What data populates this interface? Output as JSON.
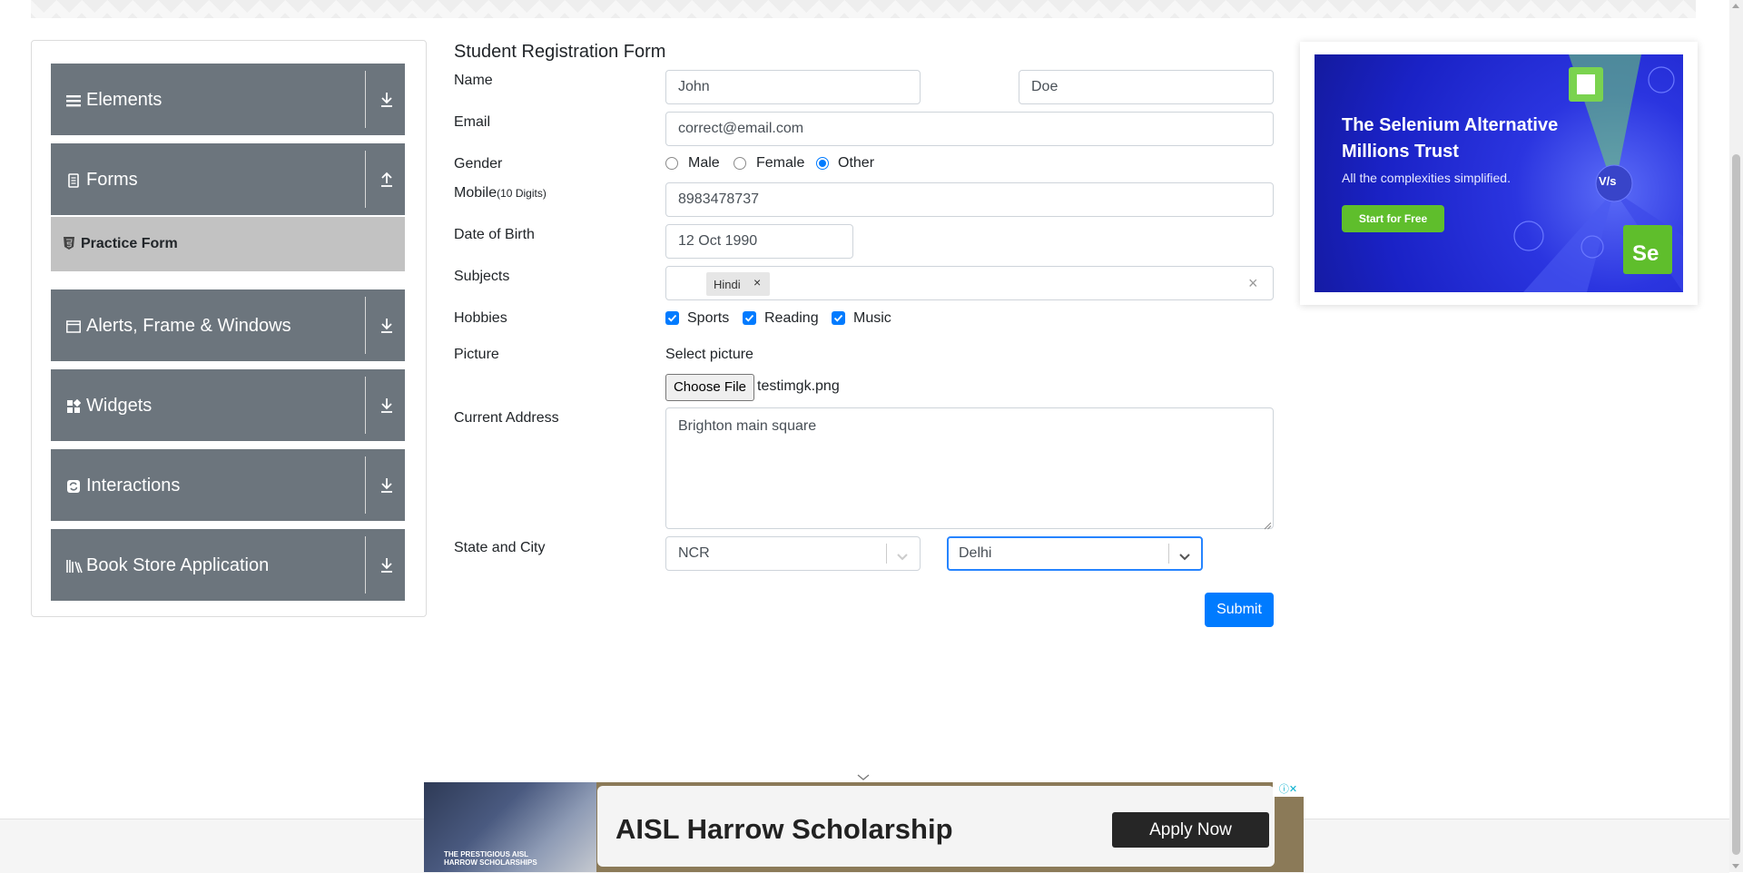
{
  "sidebar": {
    "groups": [
      {
        "label": "Elements",
        "icon": "hamburger-icon",
        "arrow": "download-icon"
      },
      {
        "label": "Forms",
        "icon": "document-icon",
        "arrow": "upload-icon"
      },
      {
        "label": "Alerts, Frame & Windows",
        "icon": "window-icon",
        "arrow": "download-icon"
      },
      {
        "label": "Widgets",
        "icon": "widgets-icon",
        "arrow": "download-icon"
      },
      {
        "label": "Interactions",
        "icon": "interactions-icon",
        "arrow": "download-icon"
      },
      {
        "label": "Book Store Application",
        "icon": "books-icon",
        "arrow": "download-icon"
      }
    ],
    "active_item": {
      "label": "Practice Form",
      "icon": "html5-icon"
    }
  },
  "form": {
    "title": "Student Registration Form",
    "name_label": "Name",
    "first_name": "John",
    "last_name": "Doe",
    "email_label": "Email",
    "email": "correct@email.com",
    "gender_label": "Gender",
    "gender_options": [
      "Male",
      "Female",
      "Other"
    ],
    "gender_selected": "Other",
    "mobile_label": "Mobile",
    "mobile_hint": "(10 Digits)",
    "mobile": "8983478737",
    "dob_label": "Date of Birth",
    "dob": "12 Oct 1990",
    "subjects_label": "Subjects",
    "subjects": [
      "Hindi"
    ],
    "chip_remove": "×",
    "clear_all": "×",
    "hobbies_label": "Hobbies",
    "hobbies": [
      {
        "label": "Sports",
        "checked": true
      },
      {
        "label": "Reading",
        "checked": true
      },
      {
        "label": "Music",
        "checked": true
      }
    ],
    "picture_label": "Picture",
    "select_picture": "Select picture",
    "choose_file": "Choose File",
    "file_name": "testimgk.png",
    "address_label": "Current Address",
    "address": "Brighton main square",
    "state_city_label": "State and City",
    "state": "NCR",
    "city": "Delhi",
    "submit": "Submit"
  },
  "side_ad": {
    "headline_1": "The Selenium Alternative",
    "headline_2": "Millions Trust",
    "subtext": "All the complexities simplified.",
    "cta": "Start for Free",
    "badge": "Se",
    "vs": "V/s"
  },
  "bottom_ad": {
    "headline": "AISL Harrow Scholarship",
    "cta": "Apply Now",
    "photo_caption_1": "THE PRESTIGIOUS AISL",
    "photo_caption_2": "HARROW SCHOLARSHIPS",
    "adchoices": "ⓘ✕"
  },
  "colors": {
    "sidebar_bg": "#6c757d",
    "active_item_bg": "#c2c2c2",
    "primary": "#007bff",
    "ad_blue": "#2b35e0",
    "ad_green": "#5fbe2c"
  }
}
